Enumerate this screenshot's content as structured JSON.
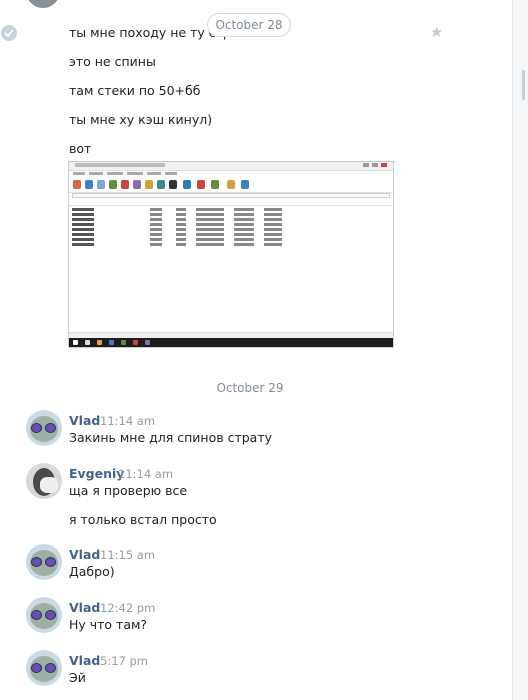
{
  "chat": {
    "date_pill": "October 28",
    "outgoing_lines": [
      "ты мне походу не ту стра",
      "это не спины",
      "там стеки по 50+бб",
      "ты мне ху кэш кинул)",
      "вот"
    ],
    "date_separator": "October 29",
    "messages": [
      {
        "author": "Vlad",
        "time": "11:14 am",
        "text": "Закинь мне для спинов страту"
      },
      {
        "author": "Evgeniy",
        "time": "11:14 am",
        "text": "ща я проверю все",
        "text2": "я только встал просто"
      },
      {
        "author": "Vlad",
        "time": "11:15 am",
        "text": "Дабро)"
      },
      {
        "author": "Vlad",
        "time": "12:42 pm",
        "text": "Ну что там?"
      },
      {
        "author": "Vlad",
        "time": "5:17 pm",
        "text": "Эй"
      }
    ]
  },
  "colors": {
    "author": "#42648b",
    "muted": "#939ba4",
    "text": "#222222"
  }
}
